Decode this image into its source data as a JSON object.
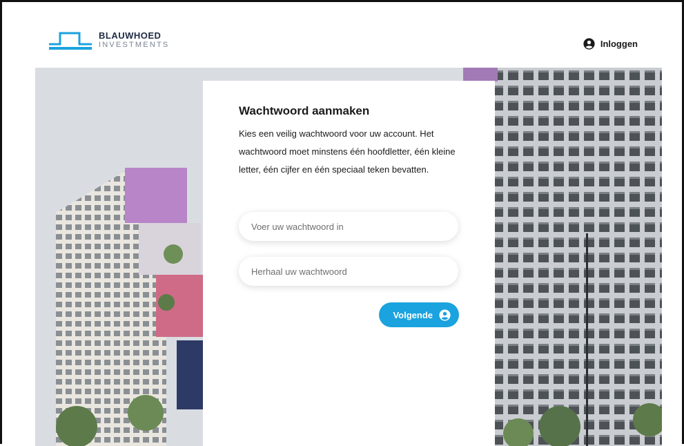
{
  "header": {
    "brand_name": "BLAUWHOED",
    "brand_sub": "INVESTMENTS",
    "login_label": "Inloggen"
  },
  "card": {
    "title": "Wachtwoord aanmaken",
    "description": "Kies een veilig wachtwoord voor uw account. Het wachtwoord moet minstens één hoofdletter, één kleine letter, één cijfer en één speciaal teken bevatten.",
    "password_placeholder": "Voer uw wachtwoord in",
    "password_value": "",
    "repeat_placeholder": "Herhaal uw wachtwoord",
    "repeat_value": "",
    "next_label": "Volgende"
  },
  "icons": {
    "login": "user-circle-icon",
    "next": "user-circle-icon",
    "logo": "brand-logo"
  },
  "colors": {
    "accent": "#1aa3de",
    "brand_dark": "#1f2a44",
    "text": "#1a1a1a"
  }
}
